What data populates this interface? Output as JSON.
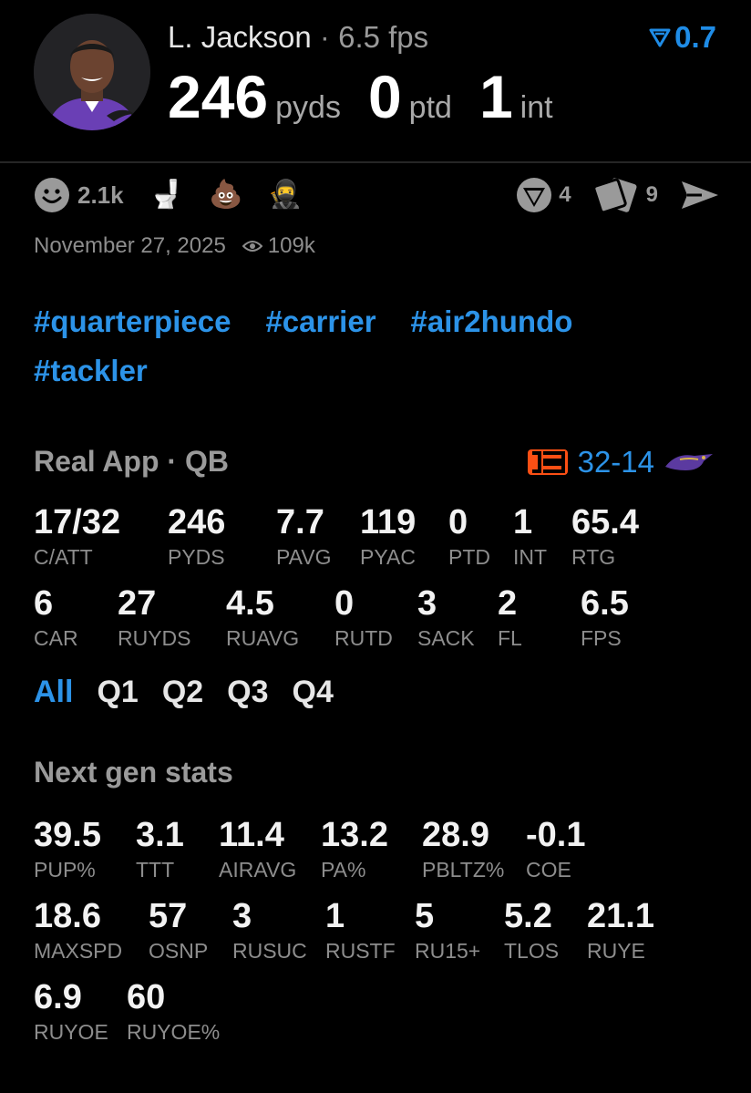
{
  "header": {
    "player_name": "L. Jackson",
    "separator": "·",
    "fps_label": "6.5 fps",
    "rating_value": "0.7",
    "headline": [
      {
        "value": "246",
        "unit": "pyds"
      },
      {
        "value": "0",
        "unit": "ptd"
      },
      {
        "value": "1",
        "unit": "int"
      }
    ]
  },
  "reactions": {
    "smile_count": "2.1k",
    "emojis": [
      "🚽",
      "💩",
      "🥷"
    ]
  },
  "actions": {
    "comments_count": "4",
    "cards_count": "9"
  },
  "meta": {
    "date": "November 27, 2025",
    "views": "109k"
  },
  "tags": [
    "#quarterpiece",
    "#carrier",
    "#air2hundo",
    "#tackler"
  ],
  "real_app": {
    "title": "Real App · QB",
    "score": "32-14",
    "row1": [
      {
        "v": "17/32",
        "l": "C/ATT"
      },
      {
        "v": "246",
        "l": "PYDS"
      },
      {
        "v": "7.7",
        "l": "PAVG"
      },
      {
        "v": "119",
        "l": "PYAC"
      },
      {
        "v": "0",
        "l": "PTD"
      },
      {
        "v": "1",
        "l": "INT"
      },
      {
        "v": "65.4",
        "l": "RTG"
      }
    ],
    "row2": [
      {
        "v": "6",
        "l": "CAR"
      },
      {
        "v": "27",
        "l": "RUYDS"
      },
      {
        "v": "4.5",
        "l": "RUAVG"
      },
      {
        "v": "0",
        "l": "RUTD"
      },
      {
        "v": "3",
        "l": "SACK"
      },
      {
        "v": "2",
        "l": "FL"
      },
      {
        "v": "6.5",
        "l": "FPS"
      }
    ]
  },
  "quarters": [
    "All",
    "Q1",
    "Q2",
    "Q3",
    "Q4"
  ],
  "next_gen": {
    "title": "Next gen stats",
    "row1": [
      {
        "v": "39.5",
        "l": "PUP%"
      },
      {
        "v": "3.1",
        "l": "TTT"
      },
      {
        "v": "11.4",
        "l": "AIRAVG"
      },
      {
        "v": "13.2",
        "l": "PA%"
      },
      {
        "v": "28.9",
        "l": "PBLTZ%"
      },
      {
        "v": "-0.1",
        "l": "COE"
      }
    ],
    "row2": [
      {
        "v": "18.6",
        "l": "MAXSPD"
      },
      {
        "v": "57",
        "l": "OSNP"
      },
      {
        "v": "3",
        "l": "RUSUC"
      },
      {
        "v": "1",
        "l": "RUSTF"
      },
      {
        "v": "5",
        "l": "RU15+"
      },
      {
        "v": "5.2",
        "l": "TLOS"
      },
      {
        "v": "21.1",
        "l": "RUYE"
      }
    ],
    "row3": [
      {
        "v": "6.9",
        "l": "RUYOE"
      },
      {
        "v": "60",
        "l": "RUYOE%"
      }
    ]
  },
  "colors": {
    "accent": "#2c93e8",
    "ravens_purple": "#5b3aa0",
    "bengals_orange": "#fb4f14"
  }
}
